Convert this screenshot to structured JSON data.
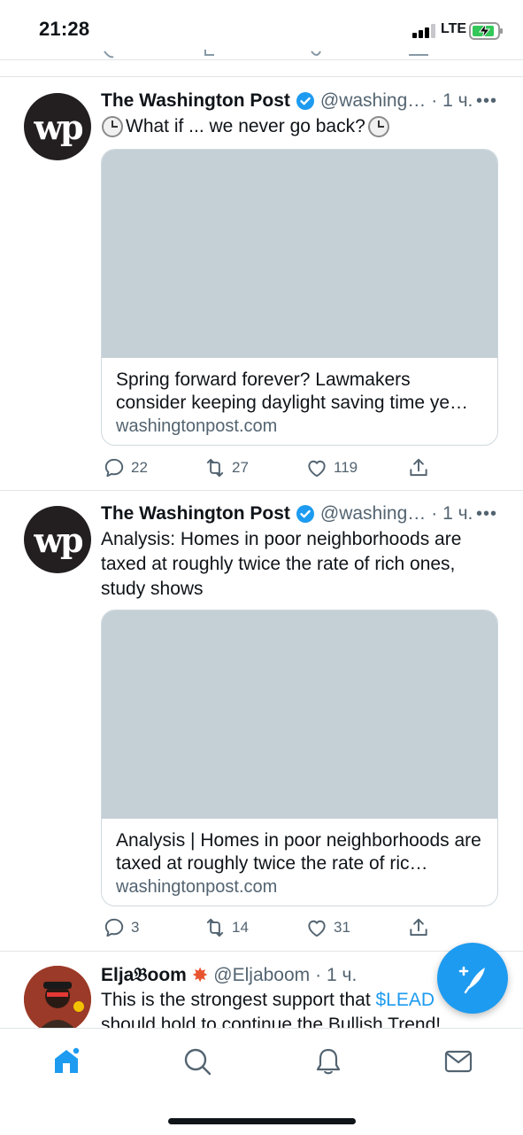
{
  "status_bar": {
    "time": "21:28",
    "network": "LTE"
  },
  "tweets": [
    {
      "author": "The Washington Post",
      "handle": "@washing…",
      "time": "· 1 ч.",
      "avatar_text": "wp",
      "text": "What if ... we never go back?",
      "card": {
        "title": "Spring forward forever? Lawmakers consider keeping daylight saving time ye…",
        "domain": "washingtonpost.com"
      },
      "replies": "22",
      "retweets": "27",
      "likes": "119"
    },
    {
      "author": "The Washington Post",
      "handle": "@washing…",
      "time": "· 1 ч.",
      "avatar_text": "wp",
      "text": "Analysis: Homes in poor neighborhoods are taxed at roughly twice the rate of rich ones, study shows",
      "card": {
        "title": "Analysis | Homes in poor neighborhoods are taxed at roughly twice the rate of ric…",
        "domain": "washingtonpost.com"
      },
      "replies": "3",
      "retweets": "14",
      "likes": "31"
    },
    {
      "author": "Elja𝔅oom",
      "handle": "@Eljaboom",
      "time": "· 1 ч.",
      "text_prefix": "This is the strongest support that ",
      "cashtag": "$LEAD",
      "text_line2": "should hold to continue the Bullish Trend!"
    }
  ],
  "colors": {
    "accent": "#1d9bf0",
    "muted": "#536471",
    "card_image": "#c5d0d6"
  },
  "icons": [
    "reply-icon",
    "retweet-icon",
    "like-icon",
    "share-icon",
    "compose-icon",
    "home-icon",
    "search-icon",
    "notifications-icon",
    "messages-icon"
  ]
}
